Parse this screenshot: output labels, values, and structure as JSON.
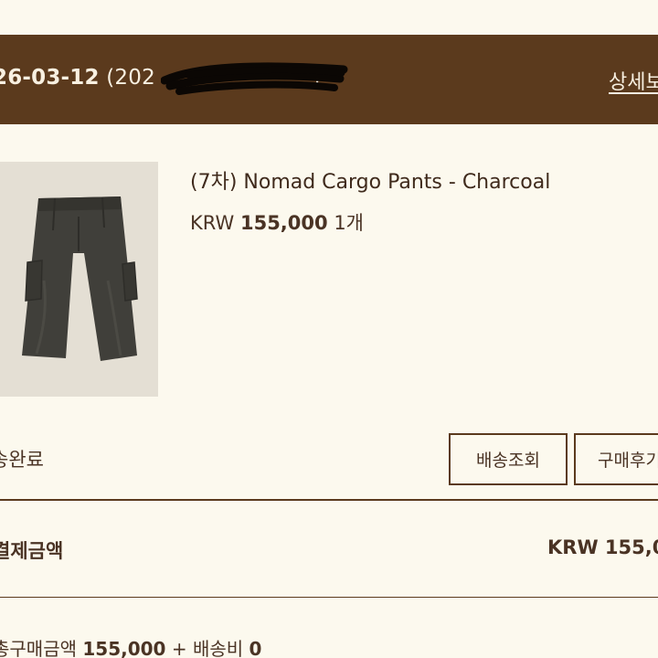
{
  "order": {
    "date": "26-03-12",
    "number_visible": "(202",
    "number_tail": ")",
    "detail_link": "상세보"
  },
  "product": {
    "name": "(7차) Nomad Cargo Pants - Charcoal",
    "currency": "KRW",
    "price": "155,000",
    "quantity": "1개",
    "image_icon": "cargo-pants-charcoal"
  },
  "status": {
    "text": "송완료"
  },
  "buttons": {
    "track_shipping": "배송조회",
    "write_review": "구매후기"
  },
  "total": {
    "label": "결제금액",
    "value": "KRW 155,0"
  },
  "summary": {
    "purchase_label": "총구매금액",
    "purchase_amount": "155,000",
    "plus": "+",
    "shipping_label": "배송비",
    "shipping_amount": "0"
  },
  "colors": {
    "header_bg": "#5b3a1d",
    "page_bg": "#fcf9ee",
    "text": "#4a3324",
    "thumb_bg": "#e4dfd4",
    "pants": "#403f3a"
  }
}
